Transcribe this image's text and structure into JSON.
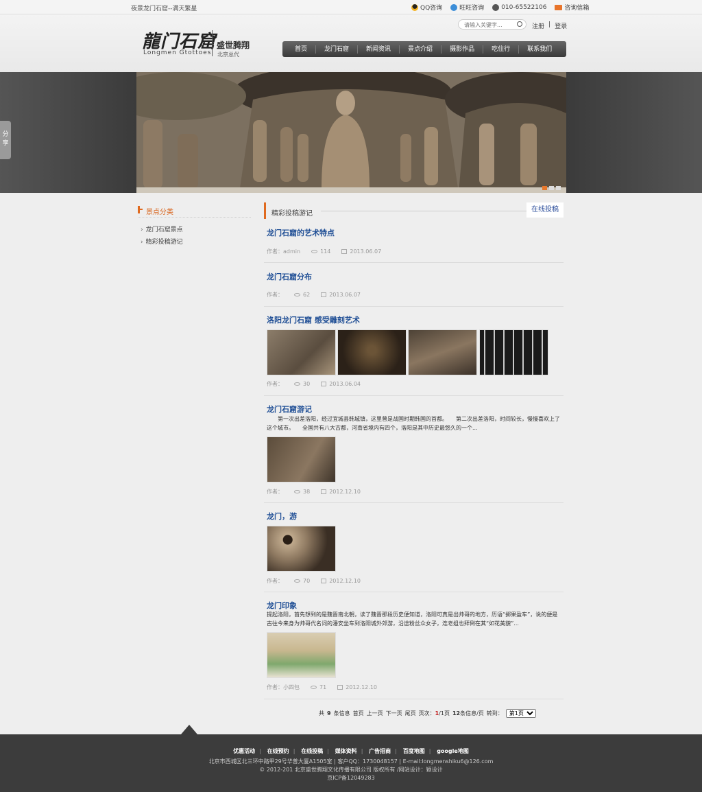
{
  "topbar": {
    "slogan": "夜景龙门石窟--满天繁星",
    "qq": "QQ咨询",
    "wangwang": "旺旺咨询",
    "phone": "010-65522106",
    "mail": "咨询信箱"
  },
  "header": {
    "logo_cn": "龍门石窟",
    "logo_en": "Longmen Gtottoes",
    "logo_sub1": "盛世腾翔",
    "logo_sub2": "北京总代",
    "search_placeholder": "请输入关键字...",
    "register": "注册",
    "login": "登录",
    "nav": [
      "首页",
      "龙门石窟",
      "新闻资讯",
      "景点介绍",
      "摄影作品",
      "吃住行",
      "联系我们"
    ]
  },
  "share": "分享",
  "sidebar": {
    "title": "景点分类",
    "items": [
      "龙门石窟景点",
      "精彩投稿游记"
    ]
  },
  "content": {
    "section_title": "精彩投稿游记",
    "submit_label": "在线投稿",
    "author_label": "作者：",
    "articles": [
      {
        "title": "龙门石窟的艺术特点",
        "author": "admin",
        "views": "114",
        "date": "2013.06.07"
      },
      {
        "title": "龙门石窟分布",
        "author": "",
        "views": "62",
        "date": "2013.06.07"
      },
      {
        "title": "洛阳龙门石窟 感受雕刻艺术",
        "author": "",
        "views": "30",
        "date": "2013.06.04"
      },
      {
        "title": "龙门石窟游记",
        "author": "",
        "views": "38",
        "date": "2012.12.10",
        "summary": "　　第一次出差洛阳，经过宜城县韩城镇，这里曾是战国时期韩国的首都。　　第二次出差洛阳，时间较长，慢慢喜欢上了这个城市。　　全国共有八大古都，河南省境内有四个，洛阳是其中历史最悠久的一个..."
      },
      {
        "title": "龙门，游",
        "author": "",
        "views": "70",
        "date": "2012.12.10"
      },
      {
        "title": "龙门印象",
        "author": "小四包",
        "views": "71",
        "date": "2012.12.10",
        "summary": "提起洛阳，首先想到的是魏晋南北朝，读了魏晋那段历史便知道，洛阳可真是出帅哥的地方，历语“掷果盈车”，说的便是古往今来身为帅哥代名词的潘安坐车到洛阳城外郊游，沿途粉丝众女子，连老姐也拜倒在其“如花美貌”..."
      }
    ]
  },
  "pager": {
    "total_prefix": "共",
    "total": "9",
    "total_suffix": "条信息",
    "first": "首页",
    "prev": "上一页",
    "next": "下一页",
    "last": "尾页",
    "page_label": "页次：",
    "page_current": "1",
    "page_rest": "/1页",
    "per_page_num": "12",
    "per_page_suffix": "条信息/页",
    "goto": "转到：",
    "select_value": "第1页"
  },
  "footer": {
    "links": [
      "优惠活动",
      "在线预约",
      "在线投稿",
      "媒体资料",
      "广告招商",
      "百度地图",
      "google地图"
    ],
    "address": "北京市西城区北三环中路甲29号华普大厦A1505室 | 客户QQ：1730048157 | E-mail:longmenshiku6@126.com",
    "copyright": "© 2012-201 北京盛世腾翔文化传播有限公司 版权所有 /网站设计：颖设计",
    "icp": "京ICP备12049283"
  },
  "colors": {
    "accent": "#e06a1f",
    "link": "#1f4e95",
    "footer_bg": "#3c3c3c"
  }
}
